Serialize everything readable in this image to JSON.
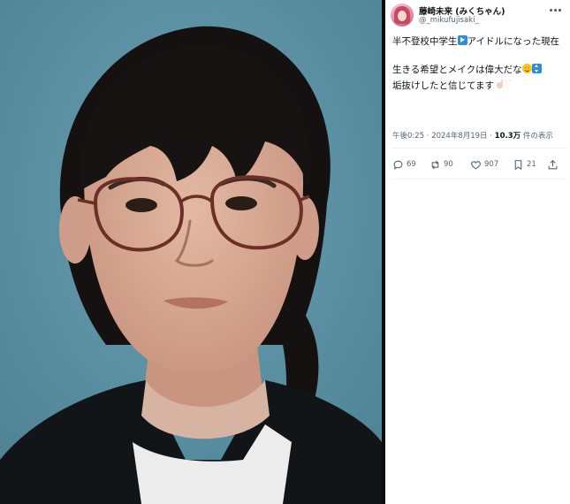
{
  "tweet": {
    "display_name": "藤崎未来 (みくちゃん)",
    "handle": "@_mikufujisaki_",
    "text_line1_part1": "半不登校中学生",
    "text_line1_part2": "アイドルになった現在",
    "text_line2_part1": "生きる希望とメイクは偉大だな",
    "text_line3": "垢抜けしたと信じてます",
    "emojis": [
      "play-button",
      "slightly-smiling-face",
      "up-down-arrow",
      "raised-hand",
      "sparkles"
    ],
    "time": "午後0:25",
    "separator": "·",
    "date": "2024年8月19日",
    "views": "10.3万",
    "views_label": "件の表示",
    "replies": "69",
    "reposts": "90",
    "likes": "907",
    "bookmarks": "21",
    "icons": {
      "more": "more-horizontal-icon",
      "reply": "reply-icon",
      "repost": "repost-icon",
      "like": "heart-icon",
      "bookmark": "bookmark-icon",
      "share": "share-icon"
    }
  },
  "colors": {
    "photo_background": "#5f92a4",
    "text_secondary": "#536471",
    "text_primary": "#0f1419",
    "divider": "#0b0b0b"
  }
}
